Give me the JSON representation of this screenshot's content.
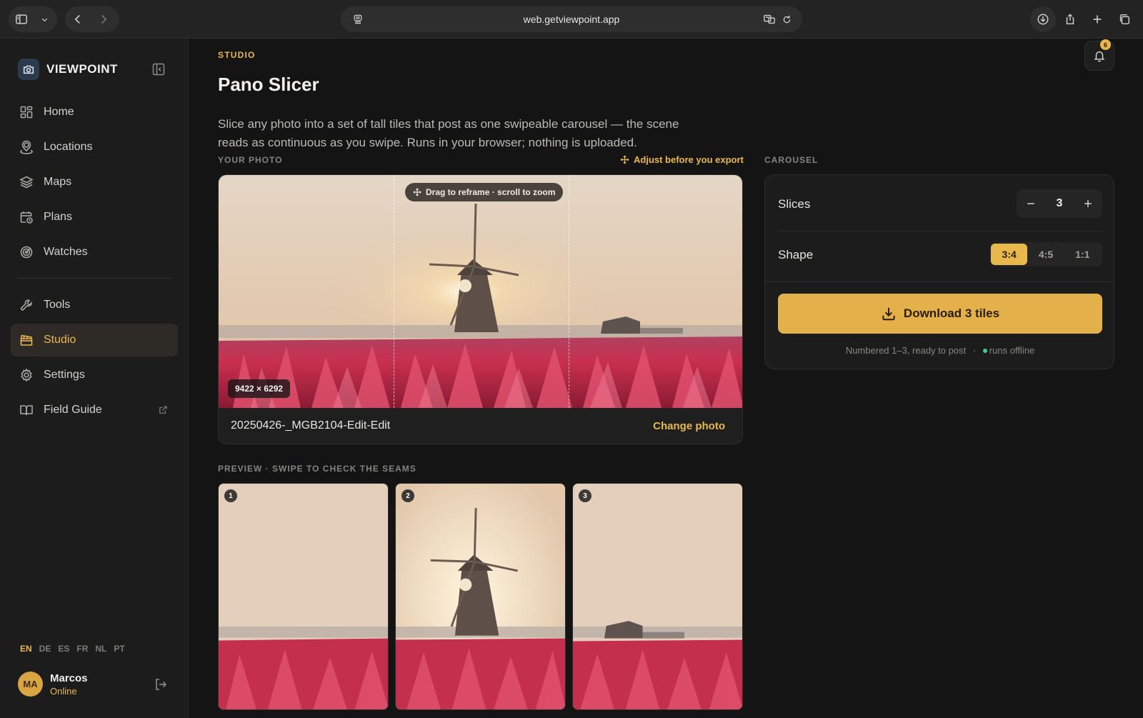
{
  "browser": {
    "url": "web.getviewpoint.app"
  },
  "brand": {
    "name": "VIEWPOINT"
  },
  "nav": {
    "home": "Home",
    "locations": "Locations",
    "maps": "Maps",
    "plans": "Plans",
    "watches": "Watches",
    "tools": "Tools",
    "studio": "Studio",
    "settings": "Settings",
    "field_guide": "Field Guide"
  },
  "languages": [
    "EN",
    "DE",
    "ES",
    "FR",
    "NL",
    "PT"
  ],
  "user": {
    "initials": "MA",
    "name": "Marcos",
    "status": "Online"
  },
  "notifications": {
    "count": "6"
  },
  "page": {
    "kicker": "STUDIO",
    "title": "Pano Slicer",
    "description": "Slice any photo into a set of tall tiles that post as one swipeable carousel — the scene reads as continuous as you swipe. Runs in your browser; nothing is uploaded."
  },
  "photo": {
    "section_label": "YOUR PHOTO",
    "adjust_hint": "Adjust before you export",
    "drag_hint": "Drag to reframe · scroll to zoom",
    "dimensions": "9422 × 6292",
    "filename": "20250426-_MGB2104-Edit-Edit",
    "change_label": "Change photo"
  },
  "preview": {
    "section_label": "PREVIEW · SWIPE TO CHECK THE SEAMS",
    "tiles": [
      "1",
      "2",
      "3"
    ]
  },
  "carousel": {
    "section_label": "CAROUSEL",
    "slices_label": "Slices",
    "slices_value": "3",
    "shape_label": "Shape",
    "shapes": [
      "3:4",
      "4:5",
      "1:1"
    ],
    "selected_shape": "3:4",
    "download_label": "Download 3 tiles",
    "footnote": "Numbered 1–3, ready to post",
    "offline_label": "runs offline"
  },
  "colors": {
    "accent": "#e9b84d",
    "background": "#141414",
    "tulip": "#d83a55"
  }
}
